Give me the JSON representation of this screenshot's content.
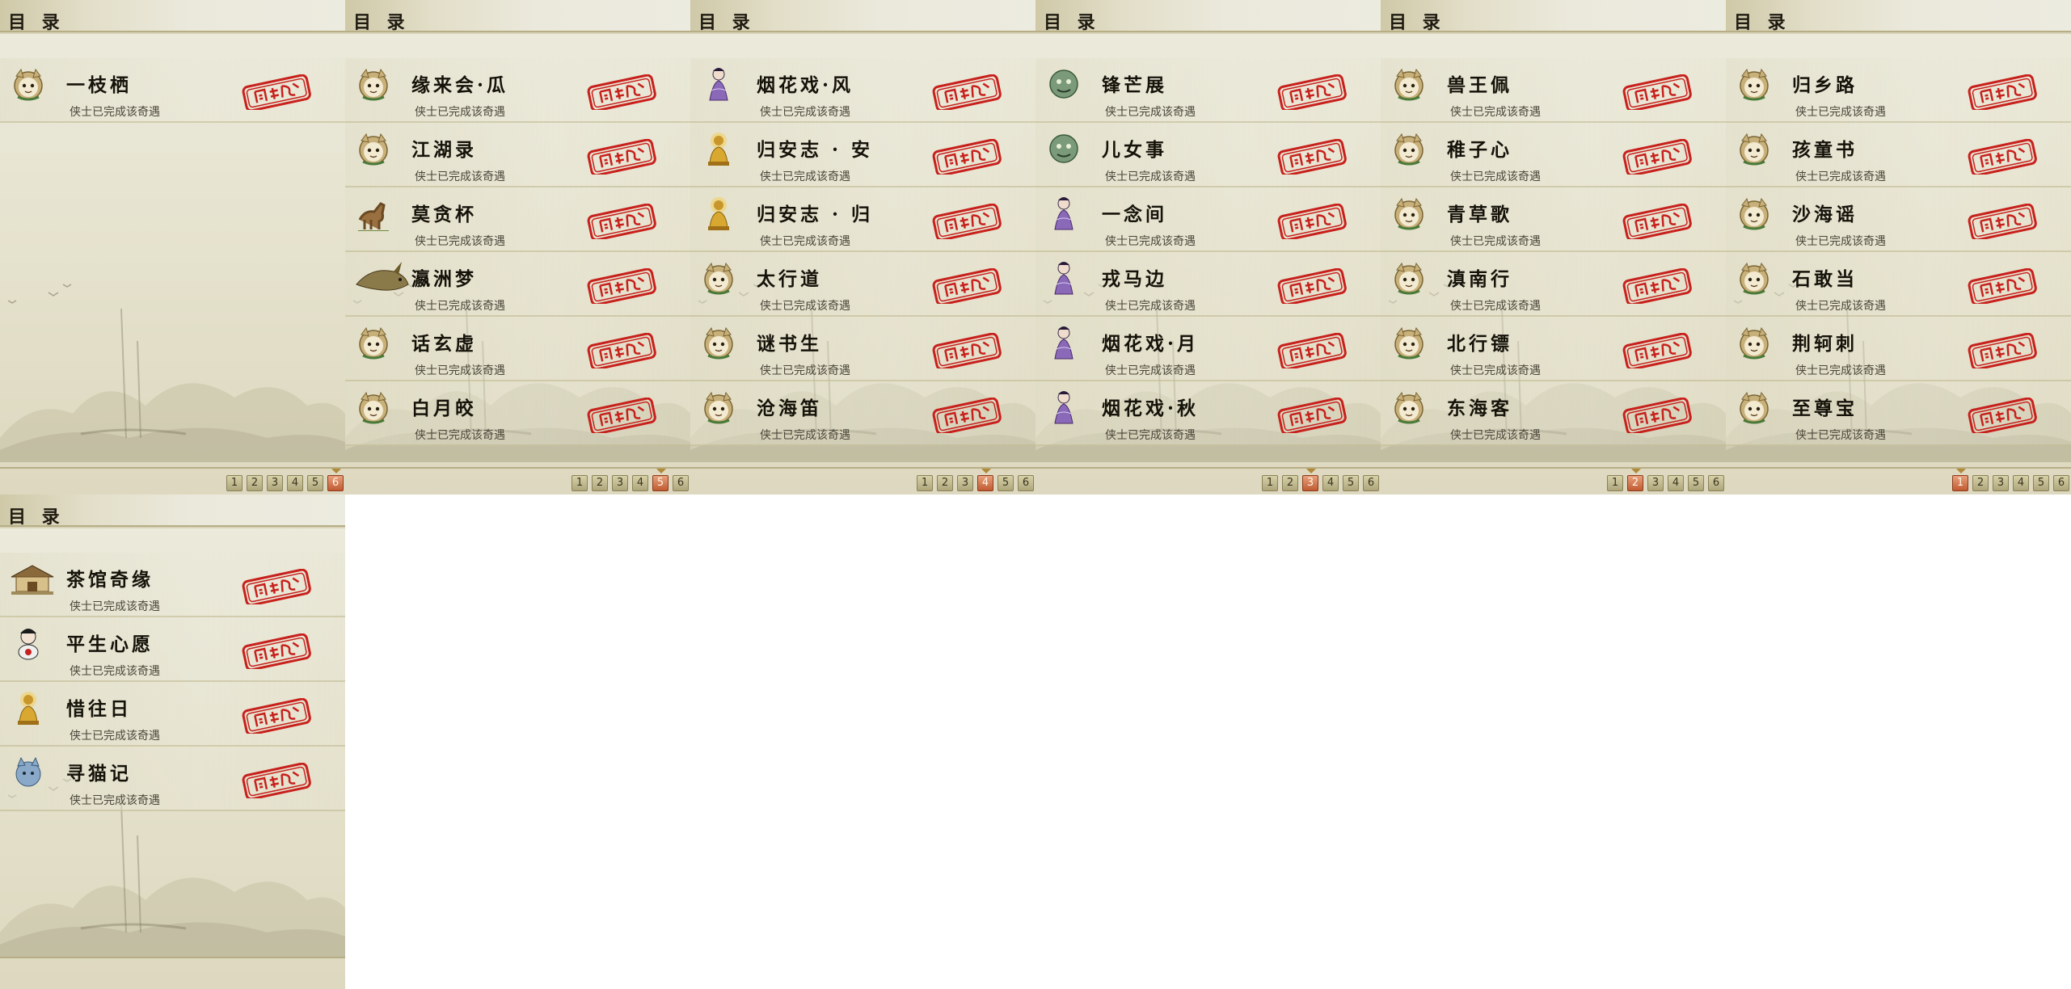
{
  "header_title": "目 录",
  "status_text": "侠士已完成该奇遇",
  "stamp_color": "#c8201c",
  "panels": [
    {
      "active_page": 6,
      "entries": [
        {
          "name": "一枝栖",
          "icon": "cat-face-icon"
        }
      ]
    },
    {
      "active_page": 5,
      "entries": [
        {
          "name": "缘来会·瓜",
          "icon": "cat-face-icon"
        },
        {
          "name": "江湖录",
          "icon": "cat-face-icon"
        },
        {
          "name": "莫贪杯",
          "icon": "horse-icon"
        },
        {
          "name": "瀛洲梦",
          "icon": "fish-icon"
        },
        {
          "name": "话玄虚",
          "icon": "cat-face-icon"
        },
        {
          "name": "白月皎",
          "icon": "cat-face-icon"
        }
      ]
    },
    {
      "active_page": 4,
      "entries": [
        {
          "name": "烟花戏·风",
          "icon": "lady-icon"
        },
        {
          "name": "归安志 · 安",
          "icon": "golden-buddha-icon"
        },
        {
          "name": "归安志 · 归",
          "icon": "golden-buddha-icon"
        },
        {
          "name": "太行道",
          "icon": "cat-face-icon"
        },
        {
          "name": "谜书生",
          "icon": "cat-face-icon"
        },
        {
          "name": "沧海笛",
          "icon": "cat-face-icon"
        }
      ]
    },
    {
      "active_page": 3,
      "entries": [
        {
          "name": "锋芒展",
          "icon": "green-monster-icon"
        },
        {
          "name": "儿女事",
          "icon": "green-monster-icon"
        },
        {
          "name": "一念间",
          "icon": "lady-icon"
        },
        {
          "name": "戎马边",
          "icon": "lady-icon"
        },
        {
          "name": "烟花戏·月",
          "icon": "lady-icon"
        },
        {
          "name": "烟花戏·秋",
          "icon": "lady-icon"
        }
      ]
    },
    {
      "active_page": 2,
      "entries": [
        {
          "name": "兽王佩",
          "icon": "cat-face-icon"
        },
        {
          "name": "稚子心",
          "icon": "cat-face-icon"
        },
        {
          "name": "青草歌",
          "icon": "cat-face-icon"
        },
        {
          "name": "滇南行",
          "icon": "cat-face-icon"
        },
        {
          "name": "北行镖",
          "icon": "cat-face-icon"
        },
        {
          "name": "东海客",
          "icon": "cat-face-icon"
        }
      ]
    },
    {
      "active_page": 1,
      "entries": [
        {
          "name": "归乡路",
          "icon": "cat-face-icon"
        },
        {
          "name": "孩童书",
          "icon": "cat-face-icon"
        },
        {
          "name": "沙海谣",
          "icon": "cat-face-icon"
        },
        {
          "name": "石敢当",
          "icon": "cat-face-icon"
        },
        {
          "name": "荆轲刺",
          "icon": "cat-face-icon"
        },
        {
          "name": "至尊宝",
          "icon": "cat-face-icon"
        }
      ]
    },
    {
      "active_page": null,
      "entries": [
        {
          "name": "茶馆奇缘",
          "icon": "teahouse-icon"
        },
        {
          "name": "平生心愿",
          "icon": "lantern-girl-icon"
        },
        {
          "name": "惜往日",
          "icon": "golden-buddha-icon"
        },
        {
          "name": "寻猫记",
          "icon": "blue-cat-icon"
        }
      ]
    }
  ],
  "pages": [
    "1",
    "2",
    "3",
    "4",
    "5",
    "6"
  ]
}
